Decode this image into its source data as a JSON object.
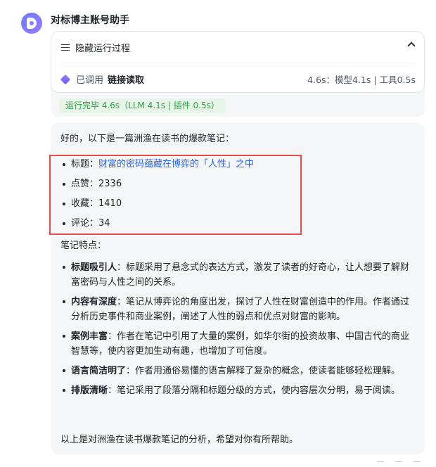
{
  "bot": {
    "name": "对标博主账号助手"
  },
  "run": {
    "toggle_label": "隐藏运行过程",
    "tool_prefix": "已调用",
    "tool_name": "链接读取",
    "tool_time": "4.6s：模型4.1s | 工具0.5s",
    "done_text": "运行完毕 4.6s（LLM 4.1s | 插件 0.5s）"
  },
  "answer": {
    "intro": "好的，以下是一篇洲渔在读书的爆款笔记：",
    "meta": {
      "title_label": "标题：",
      "title_value": "财富的密码蕴藏在博弈的「人性」之中",
      "likes_label": "点赞：",
      "likes_value": "2336",
      "favorites_label": "收藏：",
      "favorites_value": "1410",
      "comments_label": "评论：",
      "comments_value": "34"
    },
    "features_heading": "笔记特点：",
    "features": [
      {
        "name": "标题吸引人",
        "text": "：标题采用了悬念式的表达方式，激发了读者的好奇心，让人想要了解财富密码与人性之间的关系。"
      },
      {
        "name": "内容有深度",
        "text": "：笔记从博弈论的角度出发，探讨了人性在财富创造中的作用。作者通过分析历史事件和商业案例，阐述了人性的弱点和优点对财富的影响。"
      },
      {
        "name": "案例丰富",
        "text": "：作者在笔记中引用了大量的案例，如华尔街的投资故事、中国古代的商业智慧等，使内容更加生动有趣，也增加了可信度。"
      },
      {
        "name": "语言简洁明了",
        "text": "：作者用通俗易懂的语言解释了复杂的概念，使读者能够轻松理解。"
      },
      {
        "name": "排版清晰",
        "text": "：笔记采用了段落分隔和标题分级的方式，使内容层次分明，易于阅读。"
      }
    ],
    "outro": "以上是对洲渔在读书爆款笔记的分析，希望对你有所帮助。"
  }
}
